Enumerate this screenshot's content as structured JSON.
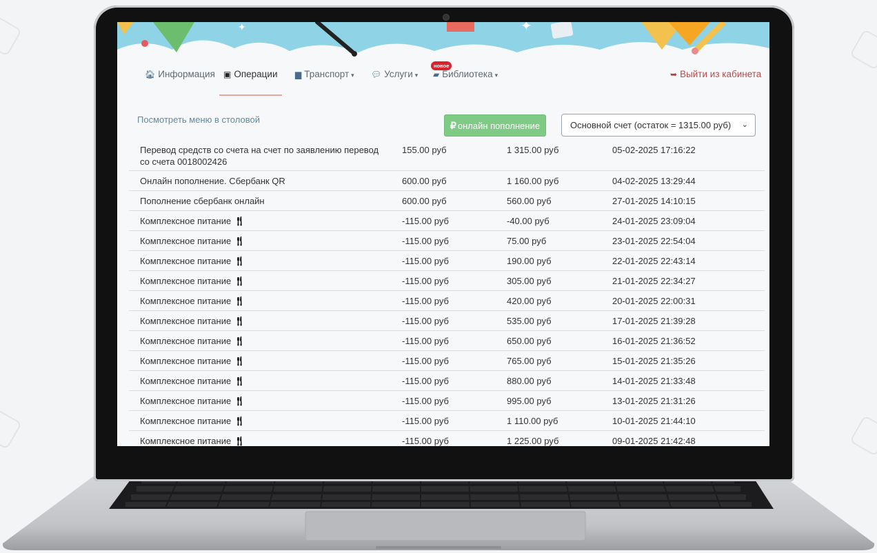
{
  "nav": {
    "items": [
      {
        "icon": "home-icon",
        "glyph": "🏠︎",
        "label": "Информация",
        "caret": ""
      },
      {
        "icon": "money-icon",
        "glyph": "▣",
        "label": "Операции",
        "caret": ""
      },
      {
        "icon": "bus-icon",
        "glyph": "▆",
        "label": "Транспорт",
        "caret": "▾"
      },
      {
        "icon": "chat-icon",
        "glyph": "💬︎",
        "label": "Услуги",
        "caret": "▾"
      },
      {
        "icon": "book-icon",
        "glyph": "▰",
        "label": "Библиотека",
        "caret": "▾"
      }
    ],
    "active_index": 1,
    "new_badge": "новое",
    "logout_icon": "sign-out-icon",
    "logout_glyph": "➥",
    "logout_label": "Выйти из кабинета"
  },
  "controls": {
    "menu_link": "Посмотреть меню в столовой",
    "topup_symbol": "₽",
    "topup_label": "онлайн пополнение",
    "account_selected": "Основной счет (остаток = 1315.00 руб)"
  },
  "operations": [
    {
      "description": "Перевод средств со счета на счет по заявлению перевод со счета 0018002426",
      "amount": "155.00 руб",
      "balance": "1 315.00 руб",
      "date": "05-02-2025 17:16:22",
      "meal": false
    },
    {
      "description": "Онлайн пополнение. Сбербанк QR",
      "amount": "600.00 руб",
      "balance": "1 160.00 руб",
      "date": "04-02-2025 13:29:44",
      "meal": false
    },
    {
      "description": "Пополнение сбербанк онлайн",
      "amount": "600.00 руб",
      "balance": "560.00 руб",
      "date": "27-01-2025 14:10:15",
      "meal": false
    },
    {
      "description": "Комплексное питание",
      "amount": "-115.00 руб",
      "balance": "-40.00 руб",
      "date": "24-01-2025 23:09:04",
      "meal": true
    },
    {
      "description": "Комплексное питание",
      "amount": "-115.00 руб",
      "balance": "75.00 руб",
      "date": "23-01-2025 22:54:04",
      "meal": true
    },
    {
      "description": "Комплексное питание",
      "amount": "-115.00 руб",
      "balance": "190.00 руб",
      "date": "22-01-2025 22:43:14",
      "meal": true
    },
    {
      "description": "Комплексное питание",
      "amount": "-115.00 руб",
      "balance": "305.00 руб",
      "date": "21-01-2025 22:34:27",
      "meal": true
    },
    {
      "description": "Комплексное питание",
      "amount": "-115.00 руб",
      "balance": "420.00 руб",
      "date": "20-01-2025 22:00:31",
      "meal": true
    },
    {
      "description": "Комплексное питание",
      "amount": "-115.00 руб",
      "balance": "535.00 руб",
      "date": "17-01-2025 21:39:28",
      "meal": true
    },
    {
      "description": "Комплексное питание",
      "amount": "-115.00 руб",
      "balance": "650.00 руб",
      "date": "16-01-2025 21:36:52",
      "meal": true
    },
    {
      "description": "Комплексное питание",
      "amount": "-115.00 руб",
      "balance": "765.00 руб",
      "date": "15-01-2025 21:35:26",
      "meal": true
    },
    {
      "description": "Комплексное питание",
      "amount": "-115.00 руб",
      "balance": "880.00 руб",
      "date": "14-01-2025 21:33:48",
      "meal": true
    },
    {
      "description": "Комплексное питание",
      "amount": "-115.00 руб",
      "balance": "995.00 руб",
      "date": "13-01-2025 21:31:26",
      "meal": true
    },
    {
      "description": "Комплексное питание",
      "amount": "-115.00 руб",
      "balance": "1 110.00 руб",
      "date": "10-01-2025 21:44:10",
      "meal": true
    },
    {
      "description": "Комплексное питание",
      "amount": "-115.00 руб",
      "balance": "1 225.00 руб",
      "date": "09-01-2025 21:42:48",
      "meal": true
    }
  ],
  "meal_icon": "cutlery-icon",
  "meal_glyph": "🍴︎",
  "colors": {
    "topup_button": "#7fcb86",
    "badge": "#d9232d",
    "logout": "#b94a48",
    "active_tab_underline": "#e9a79b",
    "banner_sky": "#8fd4e6"
  }
}
